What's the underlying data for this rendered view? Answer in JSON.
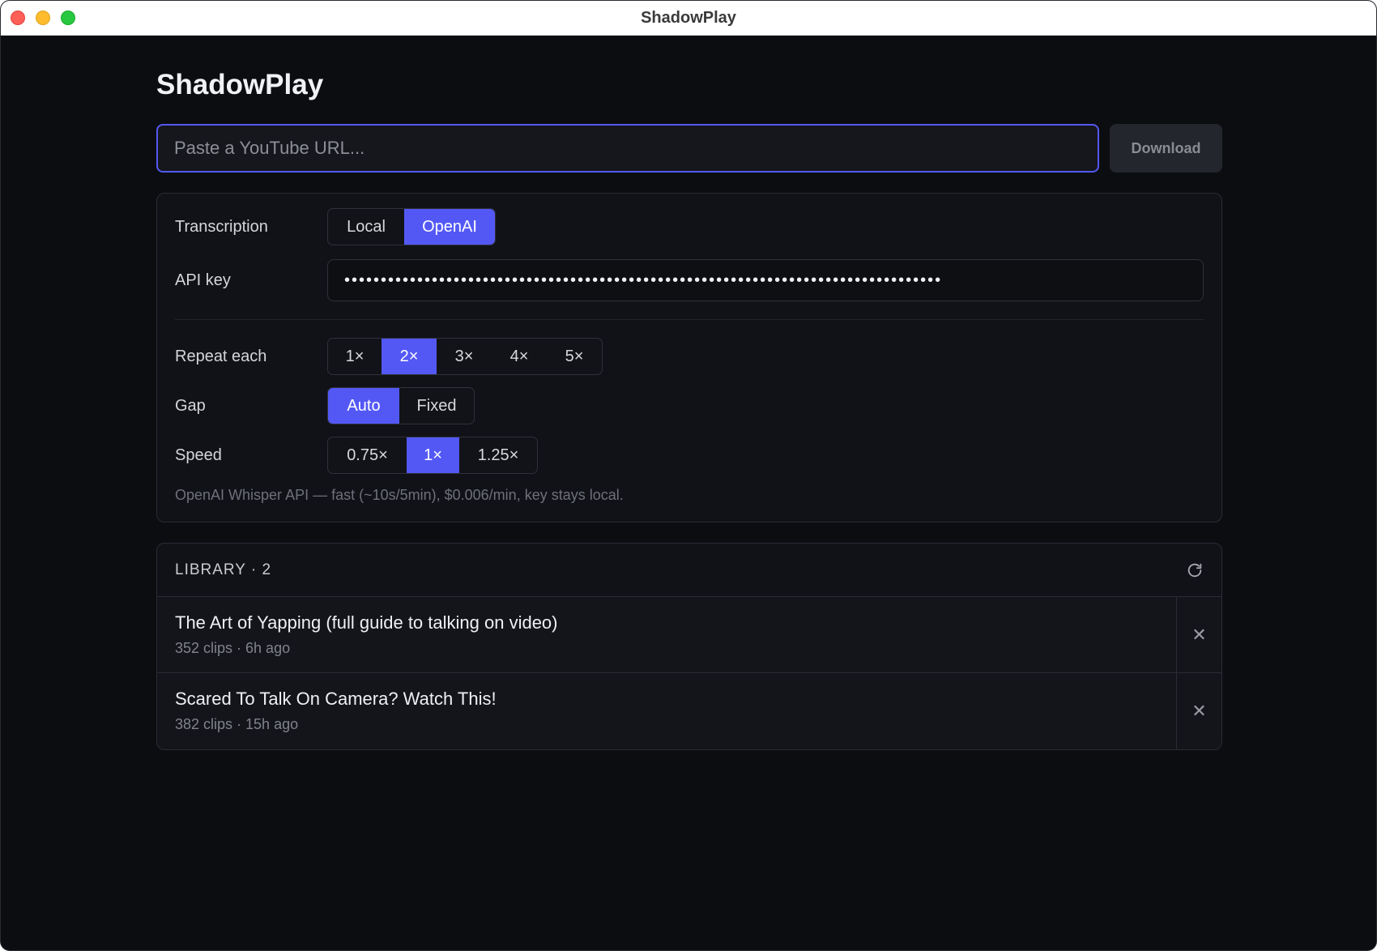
{
  "window": {
    "title": "ShadowPlay"
  },
  "app": {
    "title": "ShadowPlay"
  },
  "url_bar": {
    "placeholder": "Paste a YouTube URL...",
    "value": "",
    "download_label": "Download"
  },
  "settings": {
    "transcription": {
      "label": "Transcription",
      "options": [
        "Local",
        "OpenAI"
      ],
      "selected": "OpenAI"
    },
    "api_key": {
      "label": "API key",
      "masked_value": "••••••••••••••••••••••••••••••••••••••••••••••••••••••••••••••••••••••••••••••••••"
    },
    "repeat_each": {
      "label": "Repeat each",
      "options": [
        "1×",
        "2×",
        "3×",
        "4×",
        "5×"
      ],
      "selected": "2×"
    },
    "gap": {
      "label": "Gap",
      "options": [
        "Auto",
        "Fixed"
      ],
      "selected": "Auto"
    },
    "speed": {
      "label": "Speed",
      "options": [
        "0.75×",
        "1×",
        "1.25×"
      ],
      "selected": "1×"
    },
    "hint": "OpenAI Whisper API — fast (~10s/5min), $0.006/min, key stays local."
  },
  "library": {
    "header": "LIBRARY · 2",
    "items": [
      {
        "title": "The Art of Yapping (full guide to talking on video)",
        "meta": "352 clips  ·  6h ago"
      },
      {
        "title": "Scared To Talk On Camera? Watch This!",
        "meta": "382 clips  ·  15h ago"
      }
    ]
  },
  "colors": {
    "accent": "#5358f5",
    "background": "#0c0d11",
    "panel": "#111217"
  }
}
